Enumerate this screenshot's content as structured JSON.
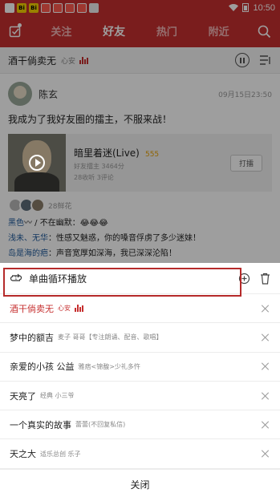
{
  "status_bar": {
    "icons": [
      "Bi",
      "Bi",
      "",
      "",
      "",
      "",
      "",
      ""
    ],
    "time": "10:50"
  },
  "header": {
    "tabs": [
      "关注",
      "好友",
      "热门",
      "附近"
    ],
    "active_tab": "好友"
  },
  "player": {
    "title": "酒干倘卖无",
    "artist": "心安"
  },
  "post": {
    "user": "陈玄",
    "time": "09月15日23:50",
    "text": "我成为了我好友圈的擂主，不服来战！",
    "song": {
      "name": "暗里着迷(Live)",
      "tag": "555",
      "meta1": "好友擂主 3464分",
      "meta2": "28收听  3评论"
    },
    "play_label": "打擂",
    "flower_count": "28鲜花",
    "comments": [
      {
        "user": "黑色",
        "sep": "〰 / ",
        "text": "不在幽默：😂😂😂"
      },
      {
        "user": "浅未、无华",
        "sep": "：",
        "text": "性感又魅惑，你的嗓音俘虏了多少迷妹！"
      },
      {
        "user": "岛是海的疤",
        "sep": "：",
        "text": "声音宽厚如深海，我已深深沦陷！"
      }
    ]
  },
  "queue": {
    "mode_label": "单曲循环播放",
    "items": [
      {
        "title": "酒干倘卖无",
        "artist": "心安",
        "playing": true
      },
      {
        "title": "梦中的额吉",
        "artist": "麦子 哥哥【专注朗诵、配音、歌唱】",
        "playing": false
      },
      {
        "title": "亲爱的小孩 公益",
        "artist": "雅痞<锦馥>少礼多忤",
        "playing": false
      },
      {
        "title": "天亮了",
        "artist": "经典 小三爷",
        "playing": false
      },
      {
        "title": "一个真实的故事",
        "artist": "蕾蕾(不回复私信)",
        "playing": false
      },
      {
        "title": "天之大",
        "artist": "适乐总创 乐子",
        "playing": false
      }
    ],
    "close_label": "关闭"
  },
  "colors": {
    "brand": "#c62f2f",
    "highlight_box": "#b52a2a"
  }
}
